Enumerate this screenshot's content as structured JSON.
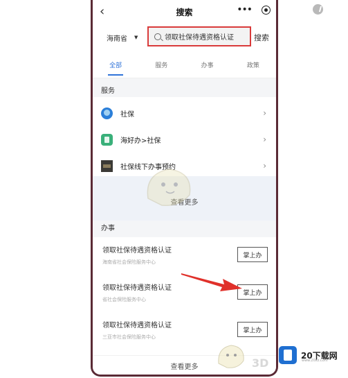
{
  "topbar": {
    "back_icon": "chevron-left-icon",
    "title": "搜索",
    "dots_icon": "more-dots-icon",
    "close_icon": "target-circle-icon"
  },
  "search": {
    "province": "海南省",
    "query": "领取社保待遇资格认证",
    "search_button": "搜索"
  },
  "tabs": [
    {
      "label": "全部",
      "active": true
    },
    {
      "label": "服务",
      "active": false
    },
    {
      "label": "办事",
      "active": false
    },
    {
      "label": "政策",
      "active": false
    }
  ],
  "services": {
    "heading": "服务",
    "items": [
      {
        "label": "社保",
        "icon": "shebao-icon"
      },
      {
        "label": "海好办>社保",
        "icon": "haihaoban-icon"
      },
      {
        "label": "社保线下办事预约",
        "icon": "appointment-icon"
      }
    ],
    "more": "查看更多"
  },
  "work": {
    "heading": "办事",
    "items": [
      {
        "title": "领取社保待遇资格认证",
        "sub": "海南省社会保险服务中心",
        "button": "掌上办"
      },
      {
        "title": "领取社保待遇资格认证",
        "sub": "省社会保险服务中心",
        "button": "掌上办"
      },
      {
        "title": "领取社保待遇资格认证",
        "sub": "三亚市社会保险服务中心",
        "button": "掌上办"
      }
    ],
    "more": "查看更多"
  },
  "watermark": {
    "brand": "20下载网",
    "url": "www.20xz.com",
    "mark_3d": "3D"
  },
  "colors": {
    "accent": "#2f73d9",
    "highlight_border": "#d93a3a",
    "arrow": "#e0302a",
    "frame": "#5a2a35"
  }
}
